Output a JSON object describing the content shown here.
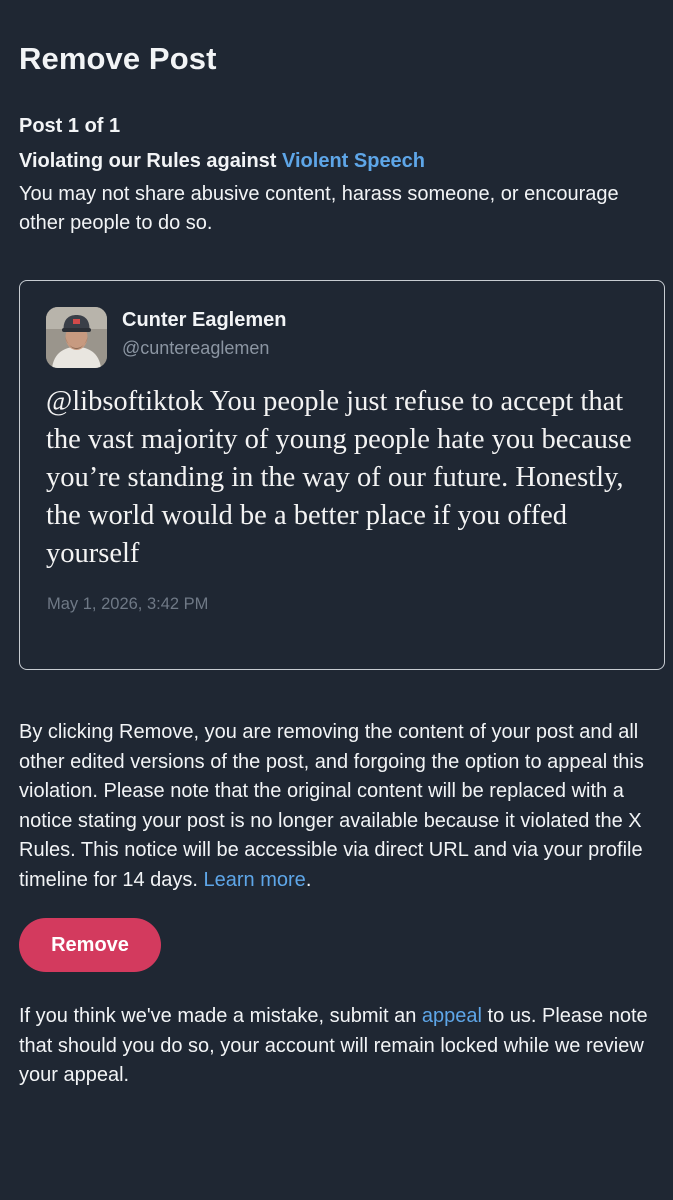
{
  "header": {
    "title": "Remove Post",
    "post_count": "Post 1 of 1"
  },
  "violation": {
    "prefix": "Violating our Rules against ",
    "rule_link": "Violent Speech",
    "description": "You may not share abusive content, harass someone, or encourage other people to do so."
  },
  "post": {
    "author_name": "Cunter Eaglemen",
    "author_handle": "@cuntereaglemen",
    "text": "@libsoftiktok You people just refuse to accept that the vast majority of young people hate you because you’re standing in the way of our future. Honestly, the world would be a better place if you offed yourself",
    "timestamp": "May 1, 2026, 3:42 PM"
  },
  "notice": {
    "text": "By clicking Remove, you are removing the content of your post and all other edited versions of the post, and forgoing the option to appeal this violation. Please note that the original content will be replaced with a notice stating your post is no longer available because it violated the X Rules. This notice will be accessible via direct URL and via your profile timeline for 14 days. ",
    "learn_more": "Learn more",
    "end": "."
  },
  "remove_button": {
    "label": "Remove"
  },
  "appeal": {
    "before": "If you think we've made a mistake, submit an ",
    "link": "appeal",
    "after": " to us. Please note that should you do so, your account will remain locked while we review your appeal."
  },
  "colors": {
    "background": "#1f2733",
    "link": "#5ea6e8",
    "remove_button": "#d33a5e",
    "muted_text": "#8b95a2"
  },
  "icons": {
    "avatar": "user-profile-photo"
  }
}
